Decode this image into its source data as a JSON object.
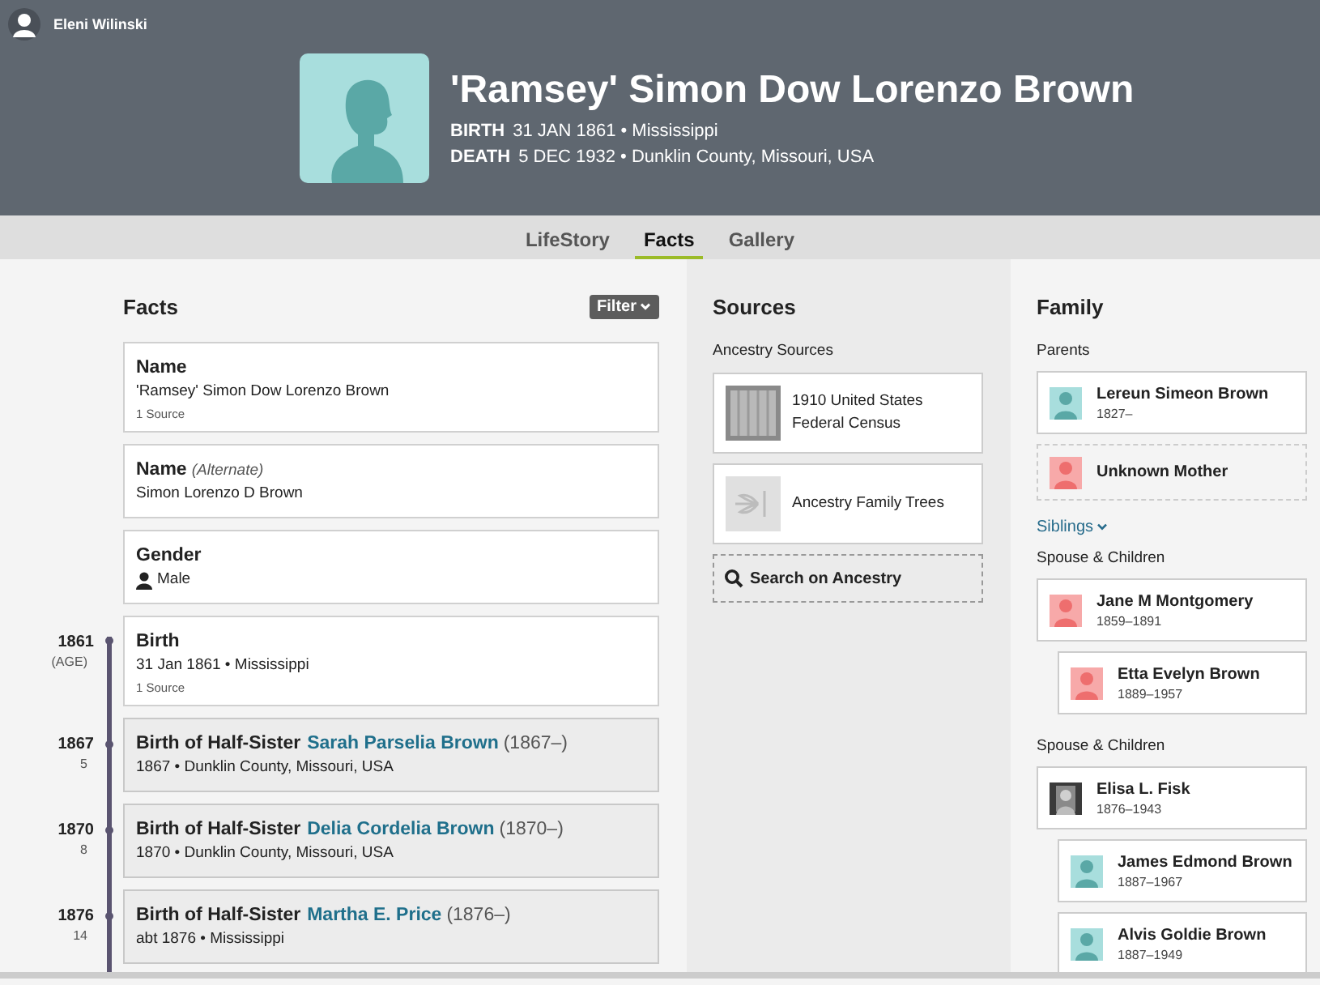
{
  "user": {
    "name": "Eleni Wilinski"
  },
  "person": {
    "name": "'Ramsey' Simon Dow Lorenzo Brown",
    "events": [
      {
        "label": "BIRTH",
        "value": "31 JAN 1861 • Mississippi"
      },
      {
        "label": "DEATH",
        "value": "5 DEC 1932 • Dunklin County, Missouri, USA"
      }
    ]
  },
  "tabs": [
    {
      "label": "LifeStory",
      "selected": false
    },
    {
      "label": "Facts",
      "selected": true
    },
    {
      "label": "Gallery",
      "selected": false
    }
  ],
  "facts": {
    "title": "Facts",
    "filter": "Filter",
    "items": [
      {
        "kind": "fact",
        "title": "Name",
        "value": "'Ramsey' Simon Dow Lorenzo Brown",
        "sources": "1 Source"
      },
      {
        "kind": "fact",
        "title": "Name",
        "qualifier": "(Alternate)",
        "value": "Simon Lorenzo D Brown"
      },
      {
        "kind": "gender",
        "title": "Gender",
        "value": "Male"
      },
      {
        "kind": "fact",
        "year": "1861",
        "age": "(AGE)",
        "title": "Birth",
        "value": "31 Jan 1861 • Mississippi",
        "sources": "1 Source"
      },
      {
        "kind": "event",
        "year": "1867",
        "age": "5",
        "title": "Birth of Half-Sister",
        "link": "Sarah Parselia Brown",
        "suffix": "(1867–)",
        "value": "1867 • Dunklin County, Missouri, USA"
      },
      {
        "kind": "event",
        "year": "1870",
        "age": "8",
        "title": "Birth of Half-Sister",
        "link": "Delia Cordelia Brown",
        "suffix": "(1870–)",
        "value": "1870 • Dunklin County, Missouri, USA"
      },
      {
        "kind": "event",
        "year": "1876",
        "age": "14",
        "title": "Birth of Half-Sister",
        "link": "Martha E. Price",
        "suffix": "(1876–)",
        "value": "abt 1876 • Mississippi"
      }
    ]
  },
  "sources": {
    "title": "Sources",
    "subtitle": "Ancestry Sources",
    "items": [
      {
        "kind": "record",
        "label": "1910 United States Federal Census"
      },
      {
        "kind": "tree",
        "label": "Ancestry Family Trees"
      }
    ],
    "search": "Search on Ancestry"
  },
  "family": {
    "title": "Family",
    "parents_heading": "Parents",
    "parents": [
      {
        "name": "Lereun Simeon Brown",
        "dates": "1827–",
        "kind": "male",
        "unknown": false
      },
      {
        "name": "Unknown Mother",
        "kind": "female",
        "unknown": true
      }
    ],
    "siblings": "Siblings",
    "spouses": [
      {
        "heading": "Spouse & Children",
        "spouse": {
          "name": "Jane M Montgomery",
          "dates": "1859–1891",
          "kind": "female"
        },
        "children": [
          {
            "name": "Etta Evelyn Brown",
            "dates": "1889–1957",
            "kind": "female"
          }
        ]
      },
      {
        "heading": "Spouse & Children",
        "spouse": {
          "name": "Elisa L. Fisk",
          "dates": "1876–1943"
        },
        "children": [
          {
            "name": "James Edmond Brown",
            "dates": "1887–1967",
            "kind": "male"
          },
          {
            "name": "Alvis Goldie Brown",
            "dates": "1887–1949",
            "kind": "male"
          }
        ]
      }
    ]
  }
}
